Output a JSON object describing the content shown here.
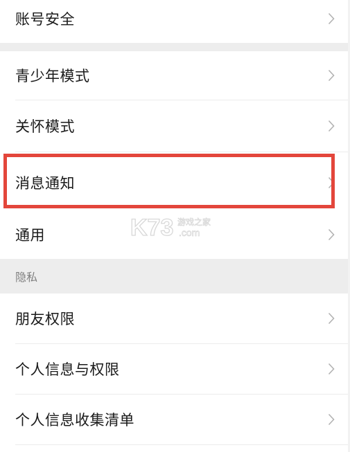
{
  "settings": {
    "items": [
      {
        "label": "账号安全"
      },
      {
        "label": "青少年模式"
      },
      {
        "label": "关怀模式"
      },
      {
        "label": "消息通知"
      },
      {
        "label": "通用"
      },
      {
        "label": "朋友权限"
      },
      {
        "label": "个人信息与权限"
      },
      {
        "label": "个人信息收集清单"
      }
    ],
    "privacy_header": "隐私"
  },
  "watermark": {
    "logo": "K73",
    "text": "游戏之家",
    "domain": ".com"
  },
  "colors": {
    "highlight": "#e3463b",
    "section_bg": "#ededed",
    "chevron": "#b2b2b2"
  },
  "icons": {
    "chevron": "chevron-right-icon"
  }
}
